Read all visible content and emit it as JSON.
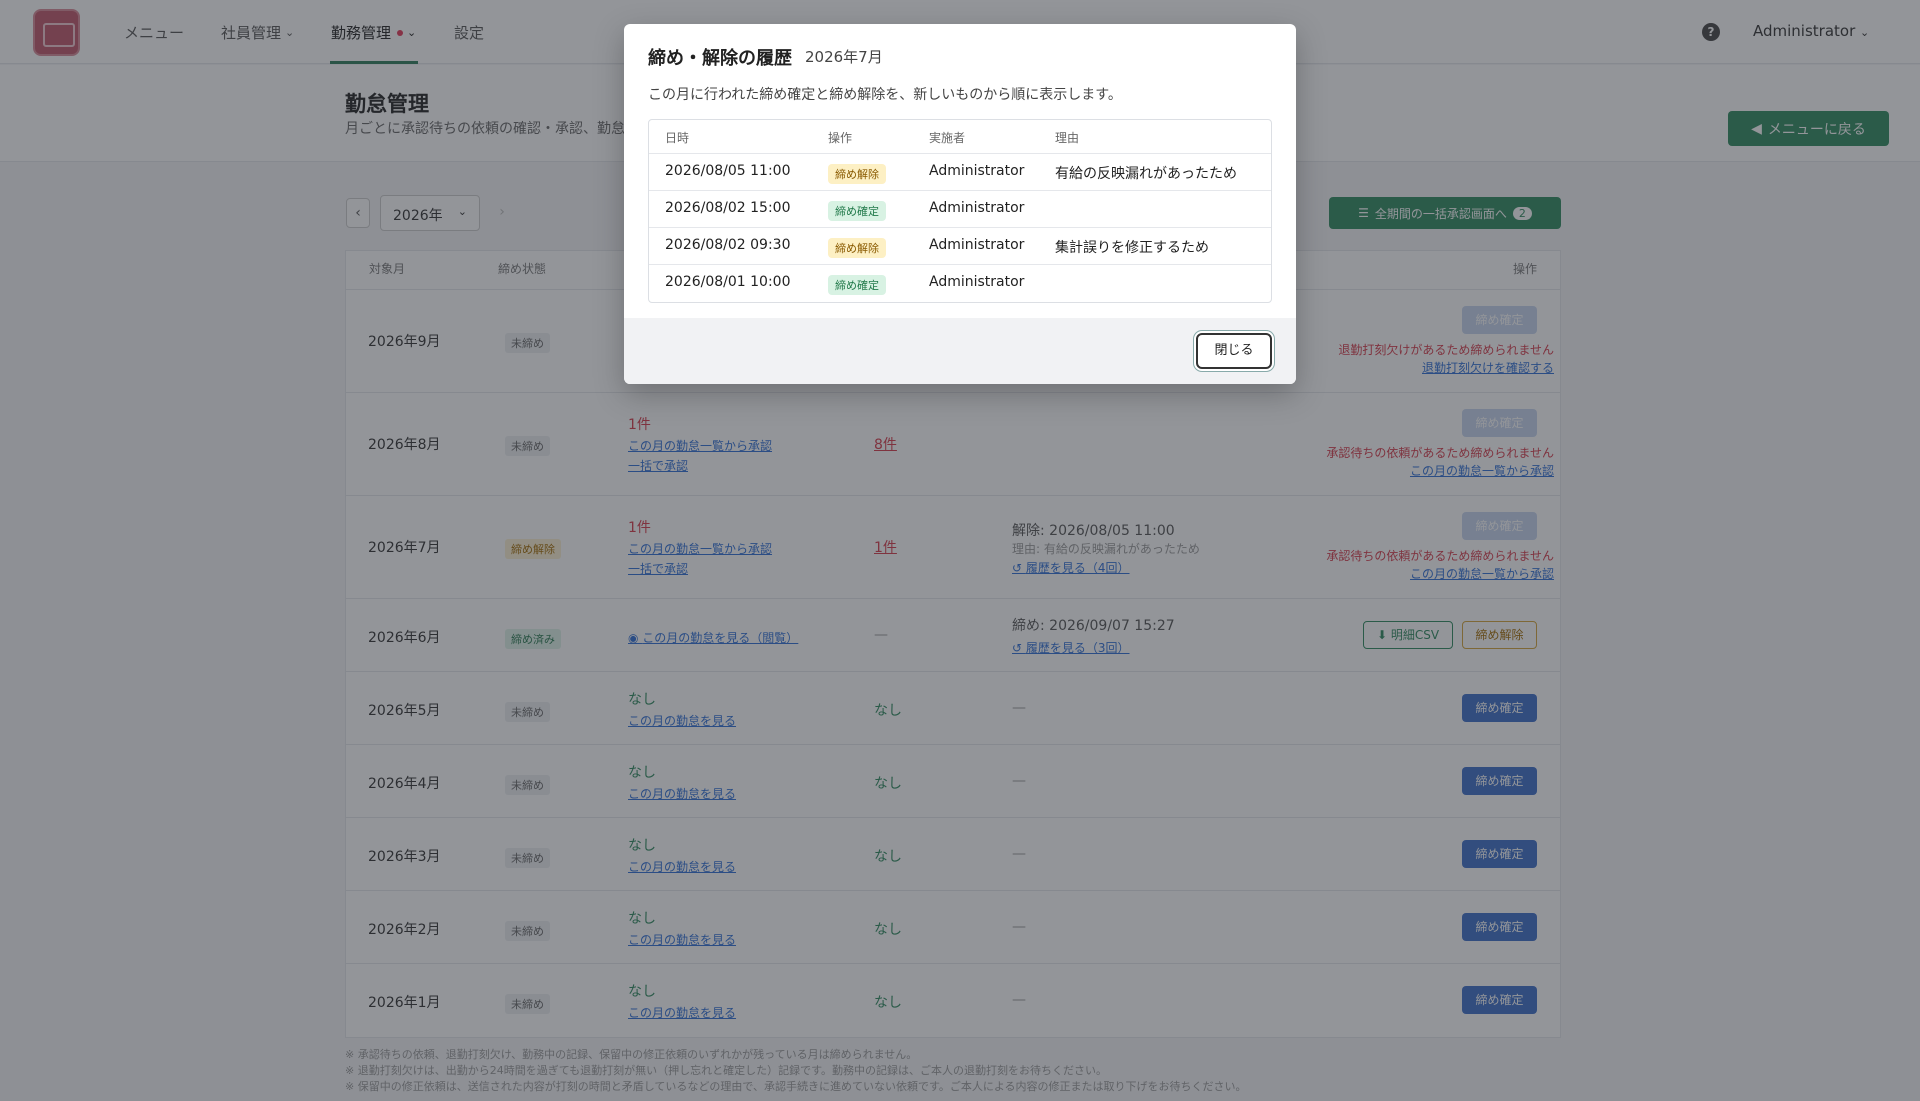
{
  "nav": {
    "menu": "メニュー",
    "employees": "社員管理",
    "attendance": "勤務管理",
    "settings": "設定",
    "user": "Administrator"
  },
  "header": {
    "title": "勤怠管理",
    "subtitle": "月ごとに承認待ちの依頼の確認・承認、勤怠",
    "back_button": "メニューに戻る"
  },
  "toolbar": {
    "year": "2026年",
    "bulk_button": "全期間の一括承認画面へ",
    "bulk_count": "2"
  },
  "table": {
    "headers": [
      "対象月",
      "締め状態",
      "操作"
    ],
    "rows": [
      {
        "month": "2026年9月",
        "status": "未締め",
        "btn": "締め確定",
        "warn1": "退勤打刻欠けがあるため締められません",
        "warn_link": "退勤打刻欠けを確認する"
      },
      {
        "month": "2026年8月",
        "status": "未締め",
        "pending": "1件",
        "link1": "この月の勤怠一覧から承認",
        "link2": "一括で承認",
        "fix": "8件",
        "btn": "締め確定",
        "warn1": "承認待ちの依頼があるため締められません",
        "warn_link": "この月の勤怠一覧から承認"
      },
      {
        "month": "2026年7月",
        "status": "締め解除",
        "pending": "1件",
        "link1": "この月の勤怠一覧から承認",
        "link2": "一括で承認",
        "fix": "1件",
        "info1": "解除: 2026/08/05 11:00",
        "info2": "理由: 有給の反映漏れがあったため",
        "history": "履歴を見る（4回）",
        "btn": "締め確定",
        "warn1": "承認待ちの依頼があるため締められません",
        "warn_link": "この月の勤怠一覧から承認"
      },
      {
        "month": "2026年6月",
        "status": "締め済み",
        "view": "この月の勤怠を見る（閲覧）",
        "fix": "—",
        "info1": "締め: 2026/09/07 15:27",
        "history": "履歴を見る（3回）",
        "csv": "明細CSV",
        "unlock": "締め解除"
      },
      {
        "month": "2026年5月",
        "status": "未締め",
        "pending": "なし",
        "link1": "この月の勤怠を見る",
        "fix": "なし",
        "dash": "—",
        "btn": "締め確定"
      },
      {
        "month": "2026年4月",
        "status": "未締め",
        "pending": "なし",
        "link1": "この月の勤怠を見る",
        "fix": "なし",
        "dash": "—",
        "btn": "締め確定"
      },
      {
        "month": "2026年3月",
        "status": "未締め",
        "pending": "なし",
        "link1": "この月の勤怠を見る",
        "fix": "なし",
        "dash": "—",
        "btn": "締め確定"
      },
      {
        "month": "2026年2月",
        "status": "未締め",
        "pending": "なし",
        "link1": "この月の勤怠を見る",
        "fix": "なし",
        "dash": "—",
        "btn": "締め確定"
      },
      {
        "month": "2026年1月",
        "status": "未締め",
        "pending": "なし",
        "link1": "この月の勤怠を見る",
        "fix": "なし",
        "dash": "—",
        "btn": "締め確定"
      }
    ]
  },
  "notes": [
    "※ 承認待ちの依頼、退勤打刻欠け、勤務中の記録、保留中の修正依頼のいずれかが残っている月は締められません。",
    "※ 退勤打刻欠けは、出勤から24時間を過ぎても退勤打刻が無い（押し忘れと確定した）記録です。勤務中の記録は、ご本人の退勤打刻をお待ちください。",
    "※ 保留中の修正依頼は、送信された内容が打刻の時間と矛盾しているなどの理由で、承認手続きに進めていない依頼です。ご本人による内容の修正または取り下げをお待ちください。"
  ],
  "modal": {
    "title": "締め・解除の履歴",
    "month": "2026年7月",
    "description": "この月に行われた締め確定と締め解除を、新しいものから順に表示します。",
    "columns": [
      "日時",
      "操作",
      "実施者",
      "理由"
    ],
    "rows": [
      {
        "datetime": "2026/08/05 11:00",
        "action": "締め解除",
        "actor": "Administrator",
        "reason": "有給の反映漏れがあったため"
      },
      {
        "datetime": "2026/08/02 15:00",
        "action": "締め確定",
        "actor": "Administrator",
        "reason": ""
      },
      {
        "datetime": "2026/08/02 09:30",
        "action": "締め解除",
        "actor": "Administrator",
        "reason": "集計誤りを修正するため"
      },
      {
        "datetime": "2026/08/01 10:00",
        "action": "締め確定",
        "actor": "Administrator",
        "reason": ""
      }
    ],
    "close_button": "閉じる"
  },
  "colors": {
    "accent": "#2f8a5f",
    "primary": "#3d6fc8",
    "danger": "#d63a4a"
  }
}
